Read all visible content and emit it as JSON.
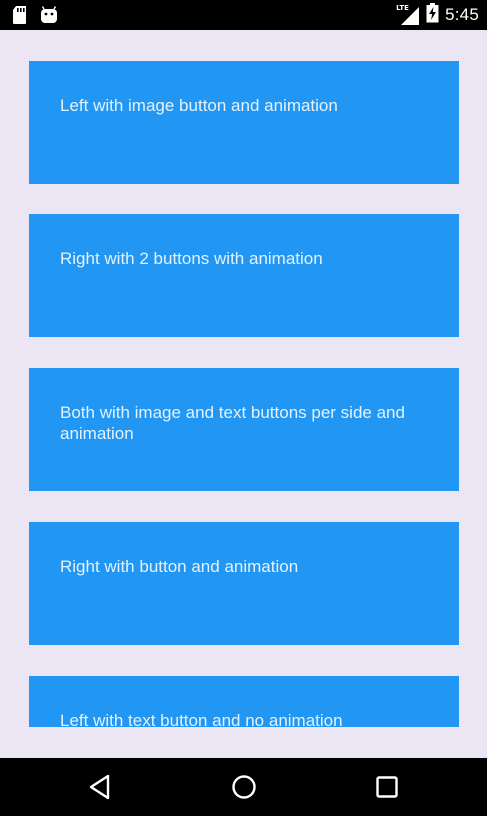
{
  "status_bar": {
    "time": "5:45",
    "network_label": "LTE",
    "icons": [
      "sd-card-icon",
      "android-icon",
      "signal-icon",
      "battery-charging-icon"
    ]
  },
  "list": {
    "items": [
      {
        "label": "Left with image button and animation"
      },
      {
        "label": "Right with 2 buttons with animation"
      },
      {
        "label": "Both with image and text buttons per side and animation"
      },
      {
        "label": "Right with button and animation"
      },
      {
        "label": "Left with text button and no animation"
      }
    ]
  },
  "navigation_bar": {
    "buttons": [
      "back-icon",
      "home-icon",
      "recents-icon"
    ]
  },
  "colors": {
    "background": "#ECE6F4",
    "card": "#2196F3",
    "card_text": "#E3F2FD",
    "system_bars": "#000000"
  }
}
